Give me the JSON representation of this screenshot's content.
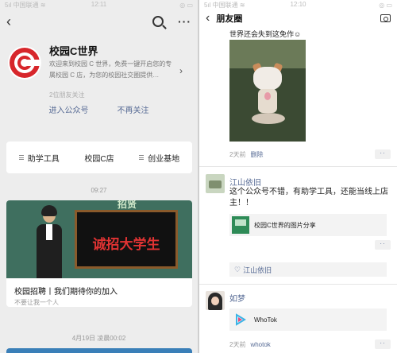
{
  "left": {
    "status": {
      "carrier": "5ıl 中国联通 ≋",
      "time": "12:11",
      "icons": "◎ ▭"
    },
    "nav": {
      "back_icon": "back-icon",
      "search_icon": "search-icon",
      "more_label": "···"
    },
    "profile": {
      "name": "校园C世界",
      "description": "欢迎来到校园 C 世界，免费一键开启您的专属校园 C 店，为您的校园社交圈提供…",
      "friends_following": "2位朋友关注",
      "chevron": "›",
      "enter_label": "进入公众号",
      "unfollow_label": "不再关注"
    },
    "menu": [
      {
        "label": "助学工具"
      },
      {
        "label": "校园C店"
      },
      {
        "label": "创业基地"
      }
    ],
    "timestamp1": "09:27",
    "article": {
      "banner_text": "诚招大学生",
      "banner_top_text": "招贤",
      "title": "校园招聘丨我们期待你的加入",
      "subtitle": "不要让我一个人"
    },
    "timestamp2": "4月19日 凌晨00:02"
  },
  "right": {
    "status": {
      "carrier": "5ıl 中国联通 ≋",
      "time": "12:10",
      "icons": "◎ ▭"
    },
    "nav": {
      "back_label": "‹",
      "title": "朋友圈"
    },
    "post1": {
      "text": "世界还会失到这免作☺",
      "time": "2天前",
      "delete": "删除"
    },
    "post2": {
      "author": "江山依旧",
      "text": "这个公众号不错，有助学工具，还能当线上店主！！",
      "share_title": "校园C世界的图片分享",
      "likes": "江山依旧"
    },
    "post3": {
      "author": "如梦",
      "share_title": "WhoTok",
      "time": "2天前",
      "source": "whotok"
    },
    "more_label": "··"
  },
  "colors": {
    "link": "#576b95",
    "logo_red": "#d7262b",
    "banner_red": "#e03333"
  }
}
